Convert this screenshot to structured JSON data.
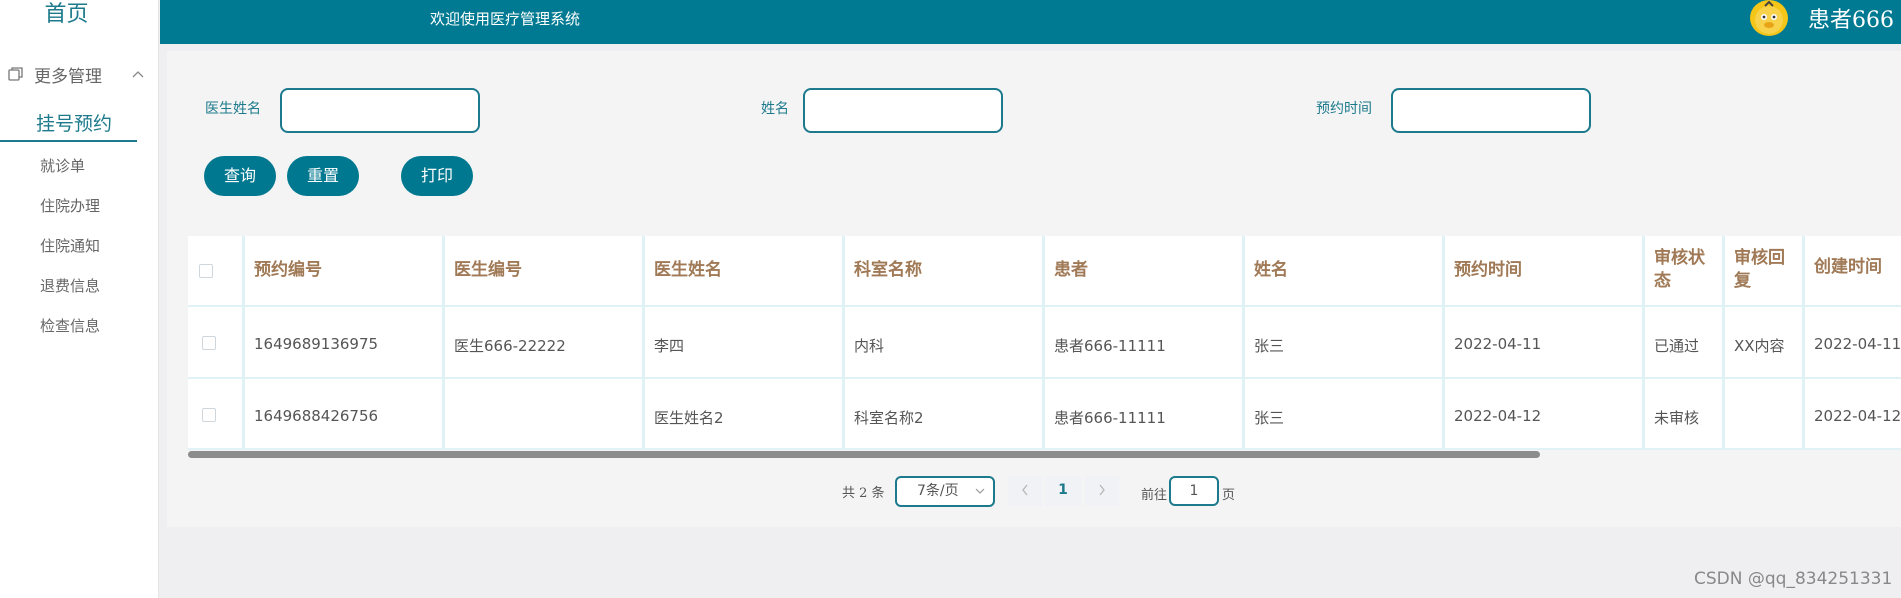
{
  "sidebar": {
    "home": "首页",
    "group_label": "更多管理",
    "active_item": "挂号预约",
    "items": [
      "就诊单",
      "住院办理",
      "住院通知",
      "退费信息",
      "检查信息"
    ]
  },
  "header": {
    "title": "欢迎使用医疗管理系统",
    "user": "患者666"
  },
  "filters": {
    "doctor_name_label": "医生姓名",
    "doctor_name_value": "",
    "name_label": "姓名",
    "name_value": "",
    "appt_time_label": "预约时间",
    "appt_time_value": ""
  },
  "buttons": {
    "query": "查询",
    "reset": "重置",
    "print": "打印"
  },
  "table": {
    "columns": [
      {
        "l1": "预约编号",
        "l2": ""
      },
      {
        "l1": "医生编号",
        "l2": ""
      },
      {
        "l1": "医生姓名",
        "l2": ""
      },
      {
        "l1": "科室名称",
        "l2": ""
      },
      {
        "l1": "患者",
        "l2": ""
      },
      {
        "l1": "姓名",
        "l2": ""
      },
      {
        "l1": "预约时间",
        "l2": ""
      },
      {
        "l1": "审核状",
        "l2": "态"
      },
      {
        "l1": "审核回",
        "l2": "复"
      },
      {
        "l1": "创建时间",
        "l2": ""
      }
    ],
    "rows": [
      [
        "1649689136975",
        "医生666-22222",
        "李四",
        "内科",
        "患者666-11111",
        "张三",
        "2022-04-11",
        "已通过",
        "XX内容",
        "2022-04-11"
      ],
      [
        "1649688426756",
        "",
        "医生姓名2",
        "科室名称2",
        "患者666-11111",
        "张三",
        "2022-04-12",
        "未审核",
        "",
        "2022-04-12"
      ]
    ]
  },
  "pagination": {
    "total_label": "共 2 条",
    "page_size": "7条/页",
    "current_page": "1",
    "goto_label": "前往",
    "goto_value": "1",
    "page_suffix": "页"
  },
  "watermark": "CSDN @qq_834251331"
}
